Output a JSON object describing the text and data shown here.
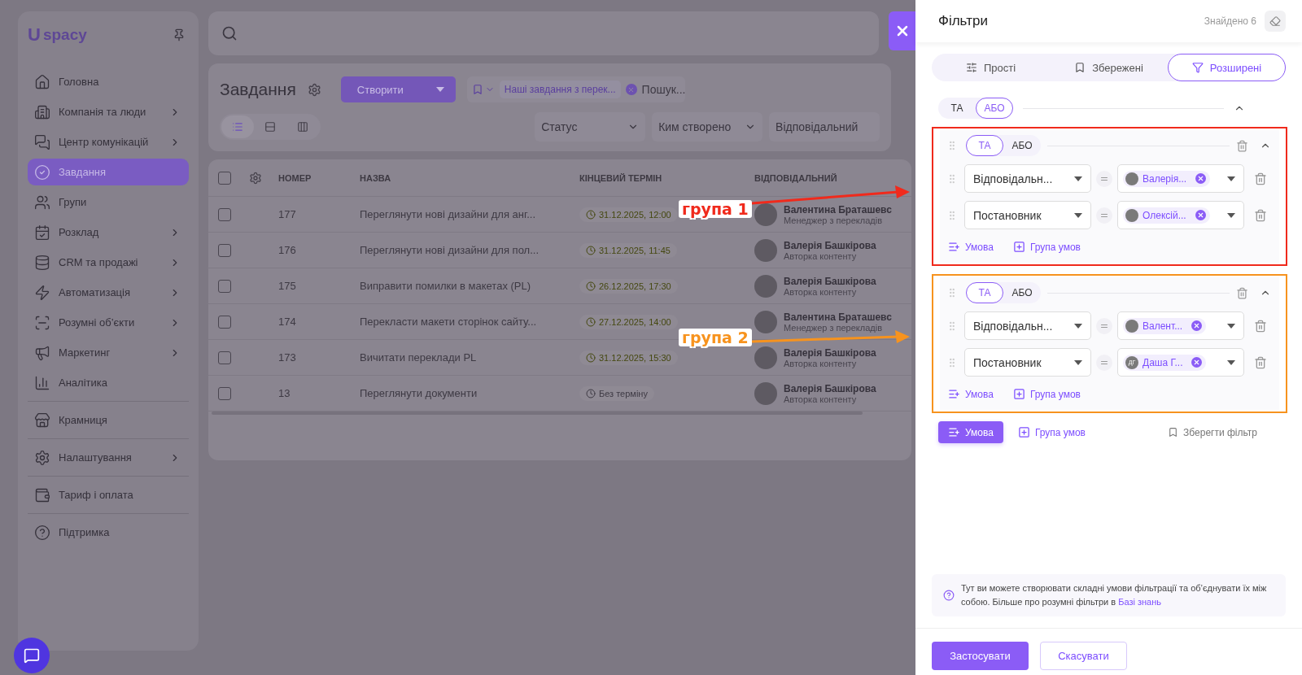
{
  "sidebar": {
    "logo": {
      "mark": "U",
      "name": "spacy"
    },
    "sections": [
      [
        {
          "label": "Головна",
          "expandable": false,
          "selected": false
        },
        {
          "label": "Компанія та люди",
          "expandable": true,
          "selected": false
        },
        {
          "label": "Центр комунікацій",
          "expandable": true,
          "selected": false
        },
        {
          "label": "Завдання",
          "expandable": false,
          "selected": true
        },
        {
          "label": "Групи",
          "expandable": false,
          "selected": false
        },
        {
          "label": "Розклад",
          "expandable": true,
          "selected": false
        },
        {
          "label": "CRM та продажі",
          "expandable": true,
          "selected": false
        },
        {
          "label": "Автоматизація",
          "expandable": true,
          "selected": false
        },
        {
          "label": "Розумні об’єкти",
          "expandable": true,
          "selected": false
        },
        {
          "label": "Маркетинг",
          "expandable": true,
          "selected": false
        },
        {
          "label": "Аналітика",
          "expandable": false,
          "selected": false
        }
      ],
      [
        {
          "label": "Крамниця",
          "expandable": false,
          "selected": false
        }
      ],
      [
        {
          "label": "Налаштування",
          "expandable": true,
          "selected": false
        }
      ],
      [
        {
          "label": "Тариф і оплата",
          "expandable": false,
          "selected": false
        }
      ],
      [
        {
          "label": "Підтримка",
          "expandable": false,
          "selected": false
        }
      ]
    ]
  },
  "tasks": {
    "title": "Завдання",
    "create_button": "Створити",
    "saved_filter_chip": "Наші завдання з перек...",
    "search_placeholder": "Пошук...",
    "quick_filters": [
      "Статус",
      "Ким створено",
      "Відповідальний"
    ],
    "view_modes": [
      {
        "selected": true
      },
      {
        "selected": false
      },
      {
        "selected": false
      }
    ]
  },
  "table": {
    "select_all": {
      "checked": false
    },
    "columns": [
      "НОМЕР",
      "НАЗВА",
      "КІНЦЕВИЙ ТЕРМІН",
      "ВІДПОВІДАЛЬНИЙ"
    ],
    "rows": [
      {
        "checked": false,
        "number": "177",
        "name": "Переглянути нові дизайни для анг...",
        "deadline": "31.12.2025, 12:00",
        "has_deadline": true,
        "assignee": "Валентина Браташевс",
        "role": "Менеджер з перекладів"
      },
      {
        "checked": false,
        "number": "176",
        "name": "Переглянути нові дизайни для пол...",
        "deadline": "31.12.2025, 11:45",
        "has_deadline": true,
        "assignee": "Валерія Башкірова",
        "role": "Авторка контенту"
      },
      {
        "checked": false,
        "number": "175",
        "name": "Виправити помилки в макетах (PL)",
        "deadline": "26.12.2025, 17:30",
        "has_deadline": true,
        "assignee": "Валерія Башкірова",
        "role": "Авторка контенту"
      },
      {
        "checked": false,
        "number": "174",
        "name": "Перекласти макети сторінок сайту...",
        "deadline": "27.12.2025, 14:00",
        "has_deadline": true,
        "assignee": "Валентина Браташевс",
        "role": "Менеджер з перекладів"
      },
      {
        "checked": false,
        "number": "173",
        "name": "Вичитати переклади PL",
        "deadline": "31.12.2025, 15:30",
        "has_deadline": true,
        "assignee": "Валерія Башкірова",
        "role": "Авторка контенту"
      },
      {
        "checked": false,
        "number": "13",
        "name": "Переглянути документи",
        "deadline": "Без терміну",
        "has_deadline": false,
        "assignee": "Валерія Башкірова",
        "role": "Авторка контенту"
      }
    ]
  },
  "filters_panel": {
    "title": "Фільтри",
    "found": "Знайдено 6",
    "tabs": [
      {
        "label": "Прості",
        "selected": false
      },
      {
        "label": "Збережені",
        "selected": false
      },
      {
        "label": "Розширені",
        "selected": true
      }
    ],
    "root_logic": [
      {
        "label": "ТА",
        "selected": false
      },
      {
        "label": "АБО",
        "selected": true
      }
    ],
    "groups": [
      {
        "annotation": {
          "label": "група 1",
          "color": "#f02a1c"
        },
        "logic": [
          {
            "label": "ТА",
            "selected": true
          },
          {
            "label": "АБО",
            "selected": false
          }
        ],
        "conditions": [
          {
            "field": "Відповідальн...",
            "value": "Валерія..."
          },
          {
            "field": "Постановник",
            "value": "Олексій..."
          }
        ],
        "add_condition": "Умова",
        "add_group": "Група умов"
      },
      {
        "annotation": {
          "label": "група 2",
          "color": "#f7931e"
        },
        "logic": [
          {
            "label": "ТА",
            "selected": true
          },
          {
            "label": "АБО",
            "selected": false
          }
        ],
        "conditions": [
          {
            "field": "Відповідальн...",
            "value": "Валент..."
          },
          {
            "field": "Постановник",
            "value": "Даша Г...",
            "initials": "ДГ"
          }
        ],
        "add_condition": "Умова",
        "add_group": "Група умов"
      }
    ],
    "add_condition": "Умова",
    "add_group": "Група умов",
    "save_filter": "Зберегти фільтр",
    "info": {
      "text": "Тут ви можете створювати складні умови фільтрації та об’єднувати їх між собою. Більше про розумні фільтри в ",
      "link": "Базі знань"
    },
    "apply": "Застосувати",
    "cancel": "Скасувати"
  }
}
